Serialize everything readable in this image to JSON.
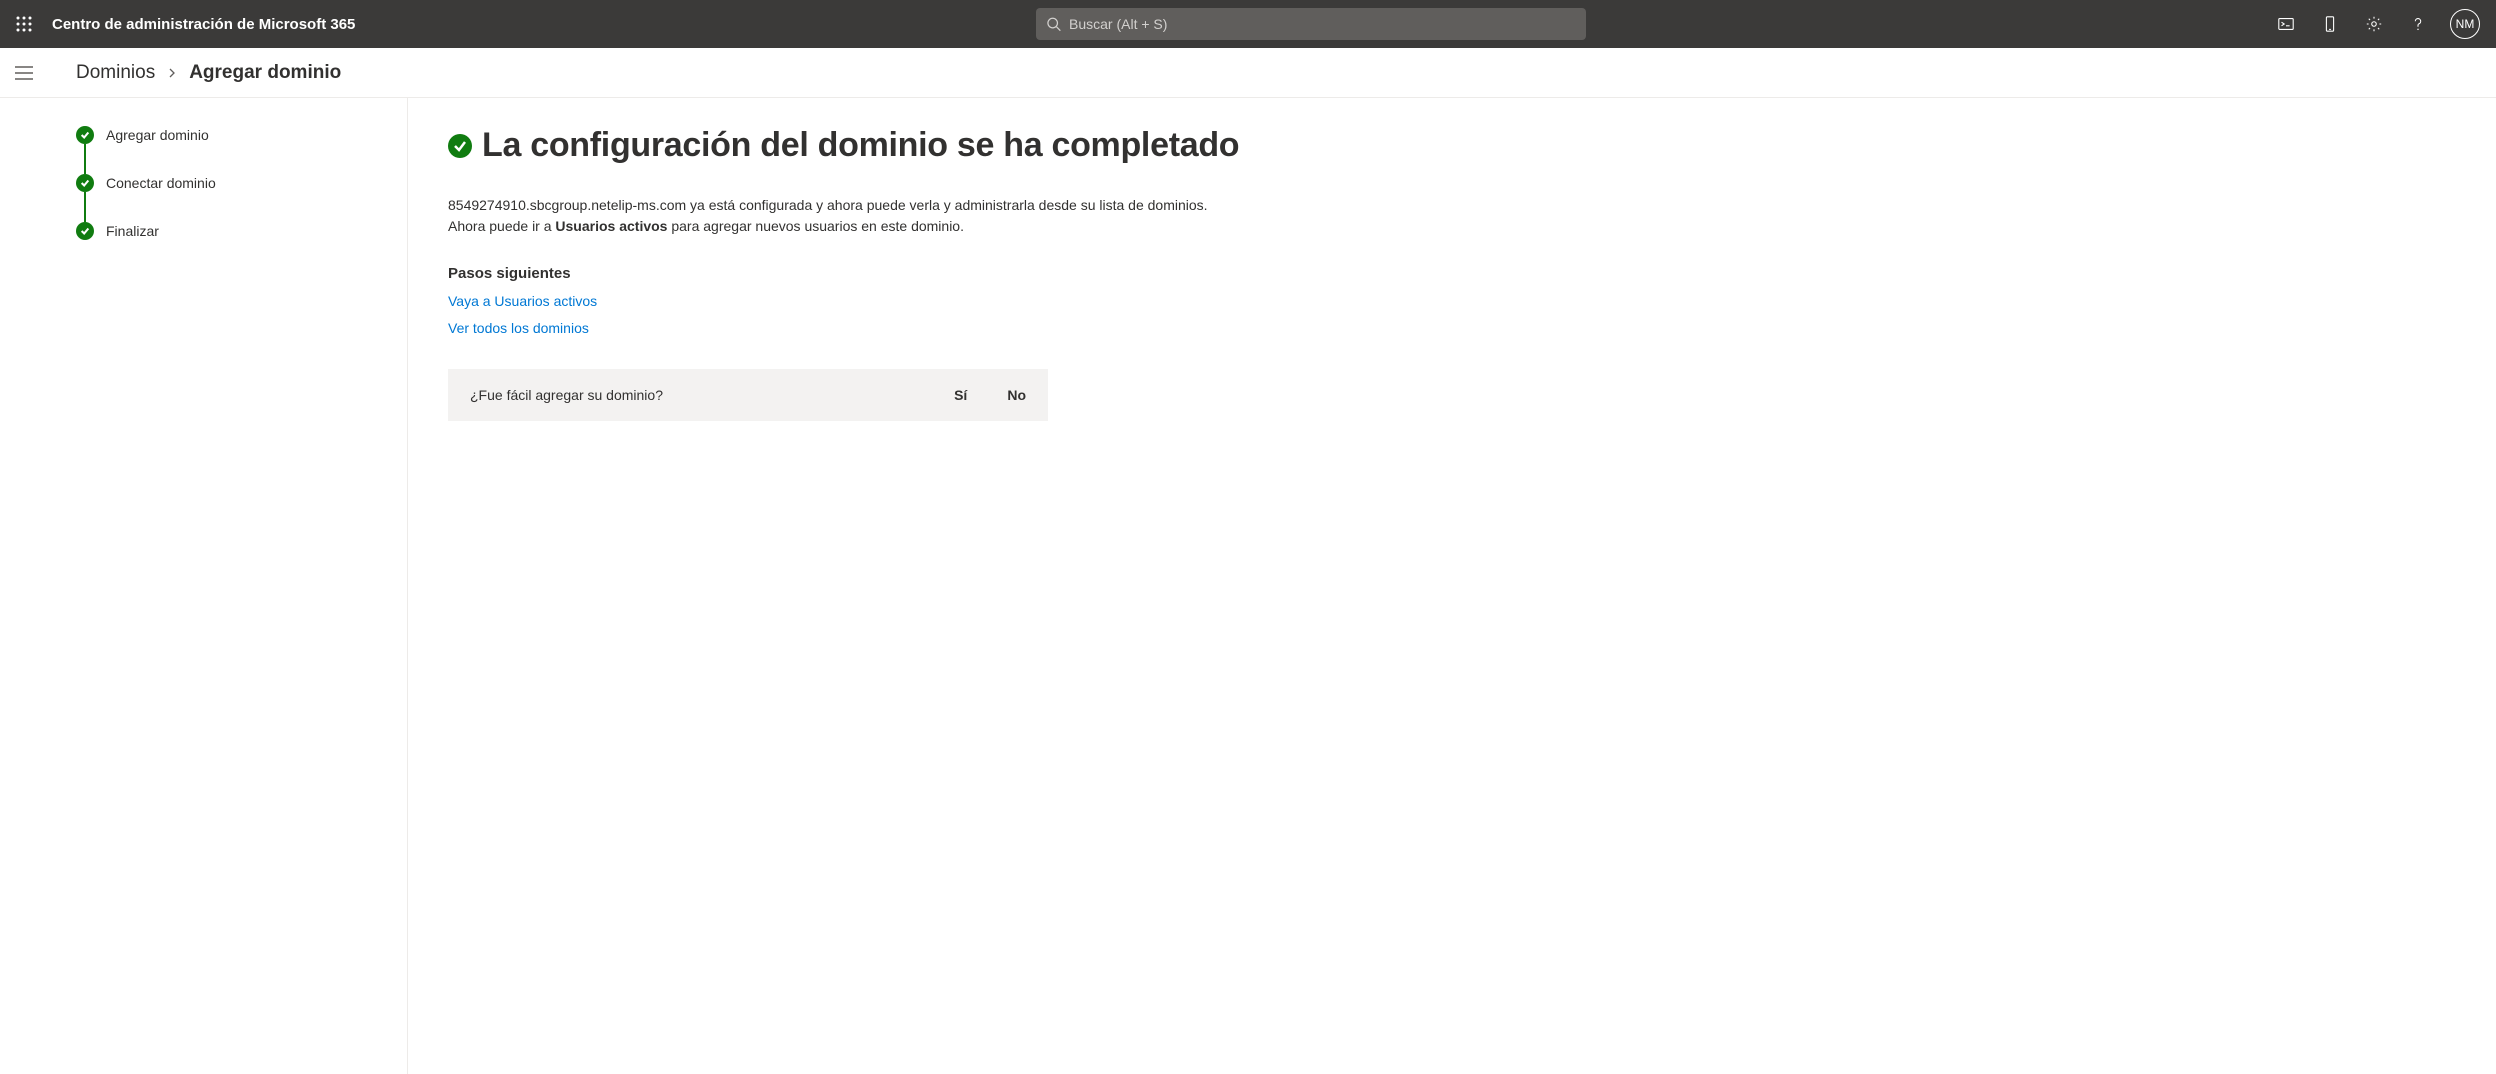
{
  "header": {
    "app_title": "Centro de administración de Microsoft 365",
    "search_placeholder": "Buscar (Alt + S)",
    "avatar_initials": "NM"
  },
  "breadcrumb": {
    "root": "Dominios",
    "current": "Agregar dominio"
  },
  "steps": [
    {
      "label": "Agregar dominio"
    },
    {
      "label": "Conectar dominio"
    },
    {
      "label": "Finalizar"
    }
  ],
  "main": {
    "title": "La configuración del dominio se ha completado",
    "desc_line1": "8549274910.sbcgroup.netelip-ms.com ya está configurada y ahora puede verla y administrarla desde su lista de dominios.",
    "desc_line2_prefix": "Ahora puede ir a ",
    "desc_line2_bold": "Usuarios activos",
    "desc_line2_suffix": " para agregar nuevos usuarios en este dominio.",
    "next_steps_heading": "Pasos siguientes",
    "link_users": "Vaya a Usuarios activos",
    "link_domains": "Ver todos los dominios",
    "feedback_question": "¿Fue fácil agregar su dominio?",
    "feedback_yes": "Sí",
    "feedback_no": "No"
  }
}
